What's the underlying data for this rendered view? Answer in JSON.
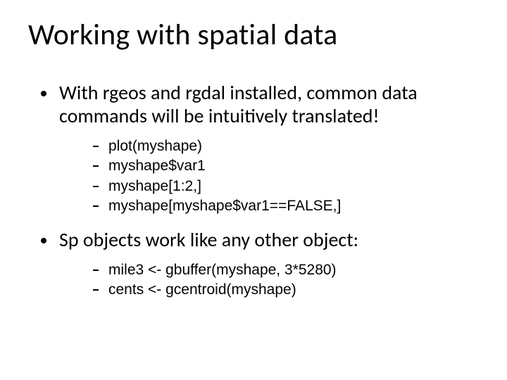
{
  "title": "Working with spatial data",
  "bullets": [
    {
      "text": "With rgeos and rgdal installed, common data commands will be intuitively translated!",
      "sub": [
        "plot(myshape)",
        "myshape$var1",
        "myshape[1:2,]",
        "myshape[myshape$var1==FALSE,]"
      ]
    },
    {
      "text": "Sp objects work like any other object:",
      "sub": [
        "mile3 <- gbuffer(myshape, 3*5280)",
        "cents <- gcentroid(myshape)"
      ]
    }
  ]
}
